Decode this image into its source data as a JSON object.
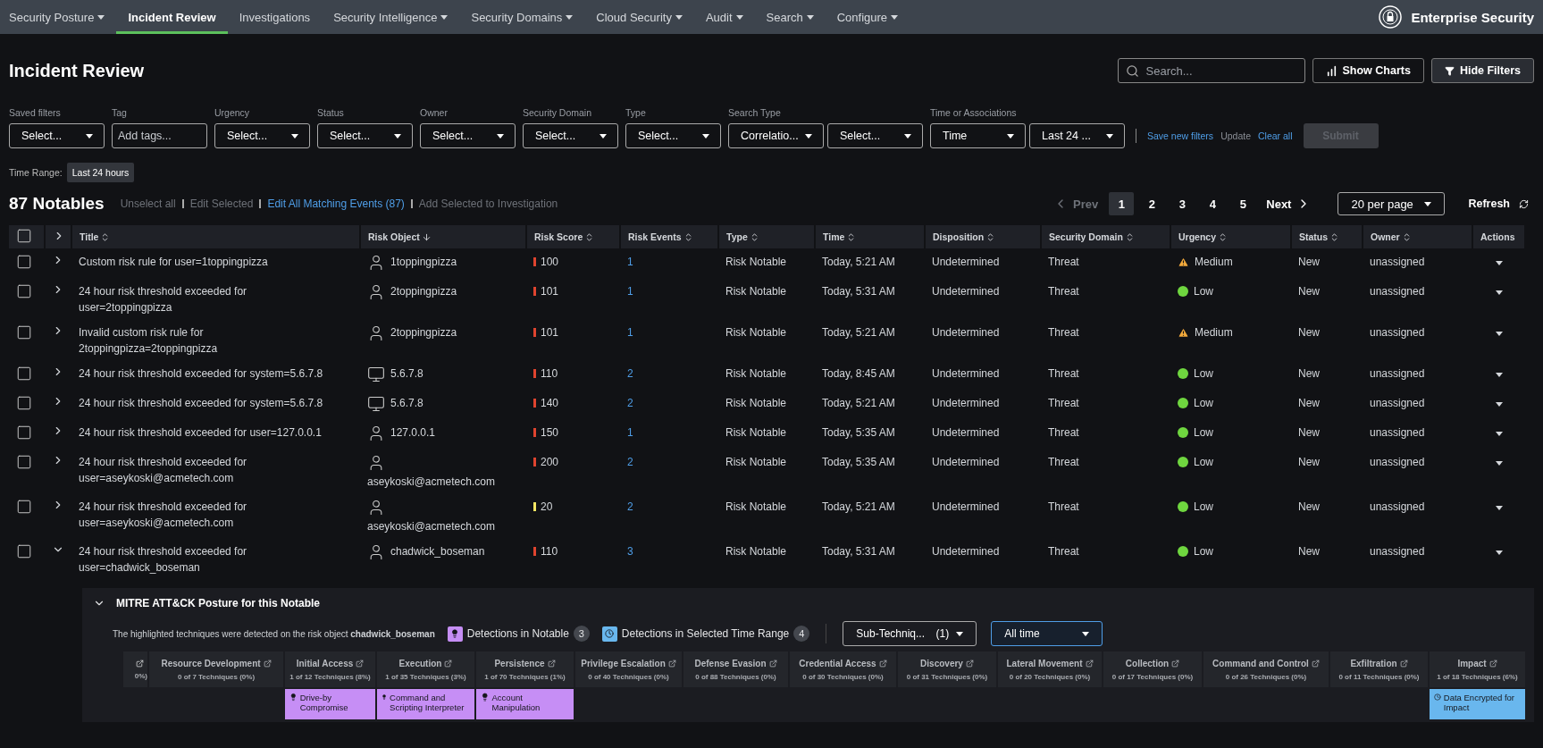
{
  "nav": {
    "items": [
      {
        "label": "Security Posture",
        "dropdown": true,
        "selected": false
      },
      {
        "label": "Incident Review",
        "dropdown": false,
        "selected": true
      },
      {
        "label": "Investigations",
        "dropdown": false,
        "selected": false
      },
      {
        "label": "Security Intelligence",
        "dropdown": true,
        "selected": false
      },
      {
        "label": "Security Domains",
        "dropdown": true,
        "selected": false
      },
      {
        "label": "Cloud Security",
        "dropdown": true,
        "selected": false
      },
      {
        "label": "Audit",
        "dropdown": true,
        "selected": false
      },
      {
        "label": "Search",
        "dropdown": true,
        "selected": false
      },
      {
        "label": "Configure",
        "dropdown": true,
        "selected": false
      }
    ],
    "brand": "Enterprise Security"
  },
  "page": {
    "title": "Incident Review",
    "search": {
      "placeholder": "Search..."
    },
    "buttons": [
      {
        "label": "Show Charts",
        "kind": "charts"
      },
      {
        "label": "Hide Filters",
        "kind": "filter"
      }
    ]
  },
  "filters": [
    {
      "label": "Saved filters",
      "fields": [
        {
          "kind": "select",
          "value": "Select..."
        }
      ]
    },
    {
      "label": "Tag",
      "fields": [
        {
          "kind": "input",
          "placeholder": "Add tags..."
        }
      ]
    },
    {
      "label": "Urgency",
      "fields": [
        {
          "kind": "select",
          "value": "Select..."
        }
      ]
    },
    {
      "label": "Status",
      "fields": [
        {
          "kind": "select",
          "value": "Select..."
        }
      ]
    },
    {
      "label": "Owner",
      "fields": [
        {
          "kind": "select",
          "value": "Select..."
        }
      ]
    },
    {
      "label": "Security Domain",
      "fields": [
        {
          "kind": "select",
          "value": "Select..."
        }
      ]
    },
    {
      "label": "Type",
      "fields": [
        {
          "kind": "select",
          "value": "Select..."
        }
      ]
    },
    {
      "label": "Search Type",
      "fields": [
        {
          "kind": "select",
          "value": "Correlatio..."
        },
        {
          "kind": "select",
          "value": "Select..."
        }
      ]
    },
    {
      "label": "Time or Associations",
      "fields": [
        {
          "kind": "select",
          "value": "Time"
        },
        {
          "kind": "select",
          "value": "Last 24 ..."
        }
      ]
    }
  ],
  "filter_actions": [
    {
      "label": "Save new filters",
      "disabled": false
    },
    {
      "label": "Update",
      "disabled": true
    },
    {
      "label": "Clear all",
      "disabled": false
    }
  ],
  "submit": {
    "label": "Submit",
    "disabled": true
  },
  "time_range": {
    "label": "Time Range:",
    "value": "Last 24 hours"
  },
  "notables": {
    "count": "87 Notables",
    "actions": [
      {
        "label": "Unselect all",
        "disabled": true
      },
      {
        "label": "Edit Selected",
        "disabled": true
      },
      {
        "label": "Edit All Matching Events (87)",
        "disabled": false
      },
      {
        "label": "Add Selected to Investigation",
        "disabled": true
      }
    ]
  },
  "pagination": {
    "prev": "Prev",
    "next": "Next",
    "pages": [
      {
        "label": "1",
        "selected": true
      },
      {
        "label": "2",
        "selected": false
      },
      {
        "label": "3",
        "selected": false
      },
      {
        "label": "4",
        "selected": false
      },
      {
        "label": "5",
        "selected": false
      }
    ],
    "per_page": "20 per page",
    "refresh": "Refresh"
  },
  "table": {
    "select_all_checked": false,
    "columns": [
      {
        "label": "Title",
        "kind": "sortable"
      },
      {
        "label": "Risk Object",
        "kind": "sorted"
      },
      {
        "label": "Risk Score",
        "kind": "sortable"
      },
      {
        "label": "Risk Events",
        "kind": "sortable"
      },
      {
        "label": "Type",
        "kind": "sortable"
      },
      {
        "label": "Time",
        "kind": "sortable"
      },
      {
        "label": "Disposition",
        "kind": "sortable"
      },
      {
        "label": "Security Domain",
        "kind": "sortable"
      },
      {
        "label": "Urgency",
        "kind": "sortable"
      },
      {
        "label": "Status",
        "kind": "sortable"
      },
      {
        "label": "Owner",
        "kind": "sortable"
      },
      {
        "label": "Actions",
        "kind": "plain"
      }
    ],
    "rows": [
      {
        "checked": false,
        "expanded": false,
        "title": "Custom risk rule for user=1toppingpizza",
        "risk_object": {
          "kind": "person",
          "label": "1toppingpizza"
        },
        "risk_score": "100",
        "color": "#e0442f",
        "risk_events": "1",
        "type": "Risk Notable",
        "time": "Today, 5:21 AM",
        "disposition": "Undetermined",
        "domain": "Threat",
        "urgency": {
          "kind": "medium",
          "label": "Medium"
        },
        "status": "New",
        "owner": "unassigned"
      },
      {
        "checked": false,
        "expanded": false,
        "title": "24 hour risk threshold exceeded for user=2toppingpizza",
        "risk_object": {
          "kind": "person",
          "label": "2toppingpizza"
        },
        "risk_score": "101",
        "color": "#e0442f",
        "risk_events": "1",
        "type": "Risk Notable",
        "time": "Today, 5:31 AM",
        "disposition": "Undetermined",
        "domain": "Threat",
        "urgency": {
          "kind": "low",
          "label": "Low"
        },
        "status": "New",
        "owner": "unassigned"
      },
      {
        "checked": false,
        "expanded": false,
        "title": "Invalid custom risk rule for 2toppingpizza=2toppingpizza",
        "risk_object": {
          "kind": "person",
          "label": "2toppingpizza"
        },
        "risk_score": "101",
        "color": "#e0442f",
        "risk_events": "1",
        "type": "Risk Notable",
        "time": "Today, 5:21 AM",
        "disposition": "Undetermined",
        "domain": "Threat",
        "urgency": {
          "kind": "medium",
          "label": "Medium"
        },
        "status": "New",
        "owner": "unassigned"
      },
      {
        "checked": false,
        "expanded": false,
        "title": "24 hour risk threshold exceeded for system=5.6.7.8",
        "risk_object": {
          "kind": "computer",
          "label": "5.6.7.8"
        },
        "risk_score": "110",
        "color": "#e0442f",
        "risk_events": "2",
        "type": "Risk Notable",
        "time": "Today, 8:45 AM",
        "disposition": "Undetermined",
        "domain": "Threat",
        "urgency": {
          "kind": "low",
          "label": "Low"
        },
        "status": "New",
        "owner": "unassigned"
      },
      {
        "checked": false,
        "expanded": false,
        "title": "24 hour risk threshold exceeded for system=5.6.7.8",
        "risk_object": {
          "kind": "computer",
          "label": "5.6.7.8"
        },
        "risk_score": "140",
        "color": "#e0442f",
        "risk_events": "2",
        "type": "Risk Notable",
        "time": "Today, 5:21 AM",
        "disposition": "Undetermined",
        "domain": "Threat",
        "urgency": {
          "kind": "low",
          "label": "Low"
        },
        "status": "New",
        "owner": "unassigned"
      },
      {
        "checked": false,
        "expanded": false,
        "title": "24 hour risk threshold exceeded for user=127.0.0.1",
        "risk_object": {
          "kind": "person",
          "label": "127.0.0.1"
        },
        "risk_score": "150",
        "color": "#e0442f",
        "risk_events": "1",
        "type": "Risk Notable",
        "time": "Today, 5:35 AM",
        "disposition": "Undetermined",
        "domain": "Threat",
        "urgency": {
          "kind": "low",
          "label": "Low"
        },
        "status": "New",
        "owner": "unassigned"
      },
      {
        "checked": false,
        "expanded": false,
        "title": "24 hour risk threshold exceeded for user=aseykoski@acmetech.com",
        "risk_object": {
          "kind": "person",
          "label": "aseykoski@acmetech.com"
        },
        "risk_score": "200",
        "color": "#e0442f",
        "risk_events": "2",
        "type": "Risk Notable",
        "time": "Today, 5:35 AM",
        "disposition": "Undetermined",
        "domain": "Threat",
        "urgency": {
          "kind": "low",
          "label": "Low"
        },
        "status": "New",
        "owner": "unassigned"
      },
      {
        "checked": false,
        "expanded": false,
        "title": "24 hour risk threshold exceeded for user=aseykoski@acmetech.com",
        "risk_object": {
          "kind": "person",
          "label": "aseykoski@acmetech.com"
        },
        "risk_score": "20",
        "color": "#f5e663",
        "risk_events": "2",
        "type": "Risk Notable",
        "time": "Today, 5:21 AM",
        "disposition": "Undetermined",
        "domain": "Threat",
        "urgency": {
          "kind": "low",
          "label": "Low"
        },
        "status": "New",
        "owner": "unassigned"
      },
      {
        "checked": false,
        "expanded": true,
        "title": "24 hour risk threshold exceeded for user=chadwick_boseman",
        "risk_object": {
          "kind": "person",
          "label": "chadwick_boseman"
        },
        "risk_score": "110",
        "color": "#e0442f",
        "risk_events": "3",
        "type": "Risk Notable",
        "time": "Today, 5:31 AM",
        "disposition": "Undetermined",
        "domain": "Threat",
        "urgency": {
          "kind": "low",
          "label": "Low"
        },
        "status": "New",
        "owner": "unassigned"
      }
    ]
  },
  "mitre": {
    "expanded": true,
    "title": "MITRE ATT&CK Posture for this Notable",
    "description": "The highlighted techniques were detected on the risk object **chadwick_boseman**",
    "legend": [
      {
        "kind": "notable",
        "label": "Detections in Notable",
        "count": "3"
      },
      {
        "kind": "time",
        "label": "Detections in Selected Time Range",
        "count": "4"
      }
    ],
    "sub_techniques": {
      "label": "Sub-Techniq...",
      "count": "(1)"
    },
    "time_select": "All time",
    "tactics": [
      {
        "kind": "partial",
        "techniques": "0%)"
      },
      {
        "kind": "full",
        "name": "Resource Development",
        "techniques": "0 of 7 Techniques (0%)"
      },
      {
        "kind": "full",
        "name": "Initial Access",
        "techniques": "1 of 12 Techniques (8%)",
        "detections": [
          {
            "kind": "notable",
            "label": "Drive-by Compromise"
          }
        ]
      },
      {
        "kind": "full",
        "name": "Execution",
        "techniques": "1 of 35 Techniques (3%)",
        "detections": [
          {
            "kind": "notable",
            "label": "Command and Scripting Interpreter"
          }
        ]
      },
      {
        "kind": "full",
        "name": "Persistence",
        "techniques": "1 of 70 Techniques (1%)",
        "detections": [
          {
            "kind": "notable",
            "label": "Account Manipulation"
          }
        ]
      },
      {
        "kind": "full",
        "name": "Privilege Escalation",
        "techniques": "0 of 40 Techniques (0%)"
      },
      {
        "kind": "full",
        "name": "Defense Evasion",
        "techniques": "0 of 88 Techniques (0%)"
      },
      {
        "kind": "full",
        "name": "Credential Access",
        "techniques": "0 of 30 Techniques (0%)"
      },
      {
        "kind": "full",
        "name": "Discovery",
        "techniques": "0 of 31 Techniques (0%)"
      },
      {
        "kind": "full",
        "name": "Lateral Movement",
        "techniques": "0 of 20 Techniques (0%)"
      },
      {
        "kind": "full",
        "name": "Collection",
        "techniques": "0 of 17 Techniques (0%)"
      },
      {
        "kind": "full",
        "name": "Command and Control",
        "techniques": "0 of 26 Techniques (0%)"
      },
      {
        "kind": "full",
        "name": "Exfiltration",
        "techniques": "0 of 11 Techniques (0%)"
      },
      {
        "kind": "full",
        "name": "Impact",
        "techniques": "1 of 18 Techniques (6%)",
        "detections": [
          {
            "kind": "time",
            "label": "Data Encrypted for Impact"
          }
        ]
      }
    ]
  }
}
